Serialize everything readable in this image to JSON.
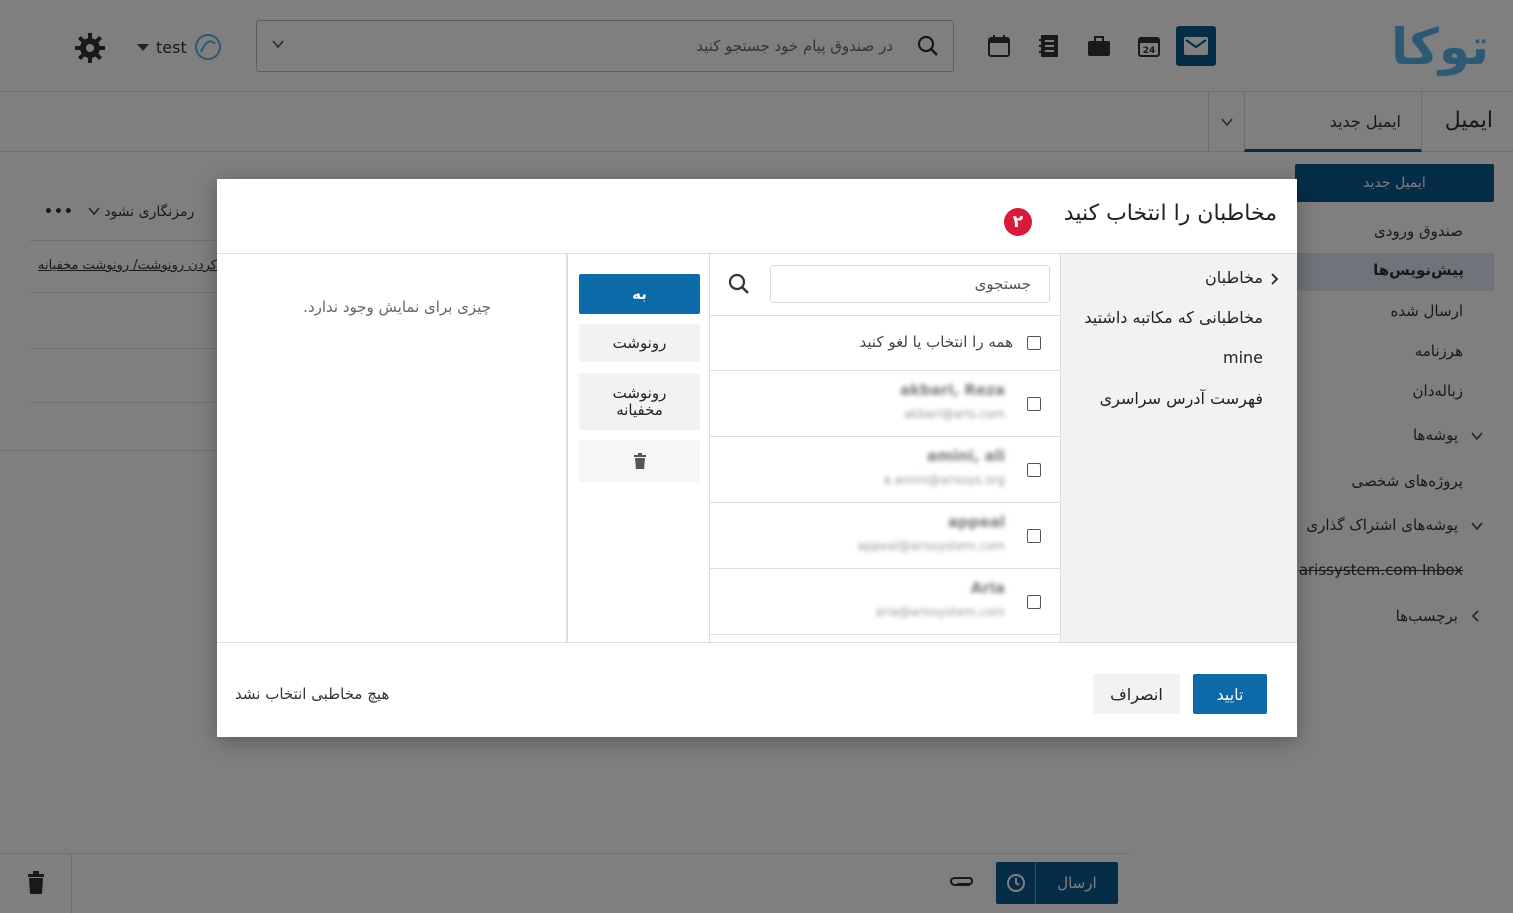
{
  "logo_text": "توکا",
  "search": {
    "placeholder": "در صندوق پیام خود جستجو کنید"
  },
  "user": {
    "name": "test"
  },
  "tabs": {
    "app": "ایمیل",
    "compose": "ایمیل جدید"
  },
  "sidebar": {
    "new_email": "ایمیل جدید",
    "items": [
      "صندوق ورودی",
      "پیش‌نویس‌ها",
      "ارسال شده",
      "هرزنامه",
      "زباله‌دان",
      "پوشه‌ها",
      "پروژه‌های شخصی",
      "پوشه‌های اشتراک گذاری",
      "arissystem.com Inbox",
      "برچسب‌ها"
    ]
  },
  "compose": {
    "option_encrypt": "رمزنگاری نشود",
    "option_more": "•••",
    "cc_link": "کردن رونوشت/ رونوشت مخفیانه",
    "send": "ارسال"
  },
  "dialog": {
    "title": "مخاطبان را انتخاب کنید",
    "badge": "۲",
    "nav": [
      "مخاطبان",
      "مخاطبانی که مکاتبه داشتید",
      "mine",
      "فهرست آدرس سراسری"
    ],
    "search_placeholder": "جستجوی",
    "select_all": "همه را انتخاب یا لغو کنید",
    "contacts": [
      {
        "name": "akbari, Reza",
        "email": "akbari@aris.com"
      },
      {
        "name": "amini, ali",
        "email": "a.amini@arissys.org"
      },
      {
        "name": "appeal",
        "email": "appeal@arissystem.com"
      },
      {
        "name": "Aria",
        "email": "aria@arissystem.com"
      }
    ],
    "actions": {
      "to": "به",
      "cc": "رونوشت",
      "bcc": "رونوشت مخفیانه"
    },
    "empty": "چیزی برای نمایش وجود ندارد.",
    "confirm": "تایید",
    "cancel": "انصراف",
    "no_selection": "هیچ مخاطبی انتخاب نشد"
  },
  "colors": {
    "accent": "#0d5a8e",
    "badge": "#d81b3a",
    "logo": "#5ab3ea"
  }
}
